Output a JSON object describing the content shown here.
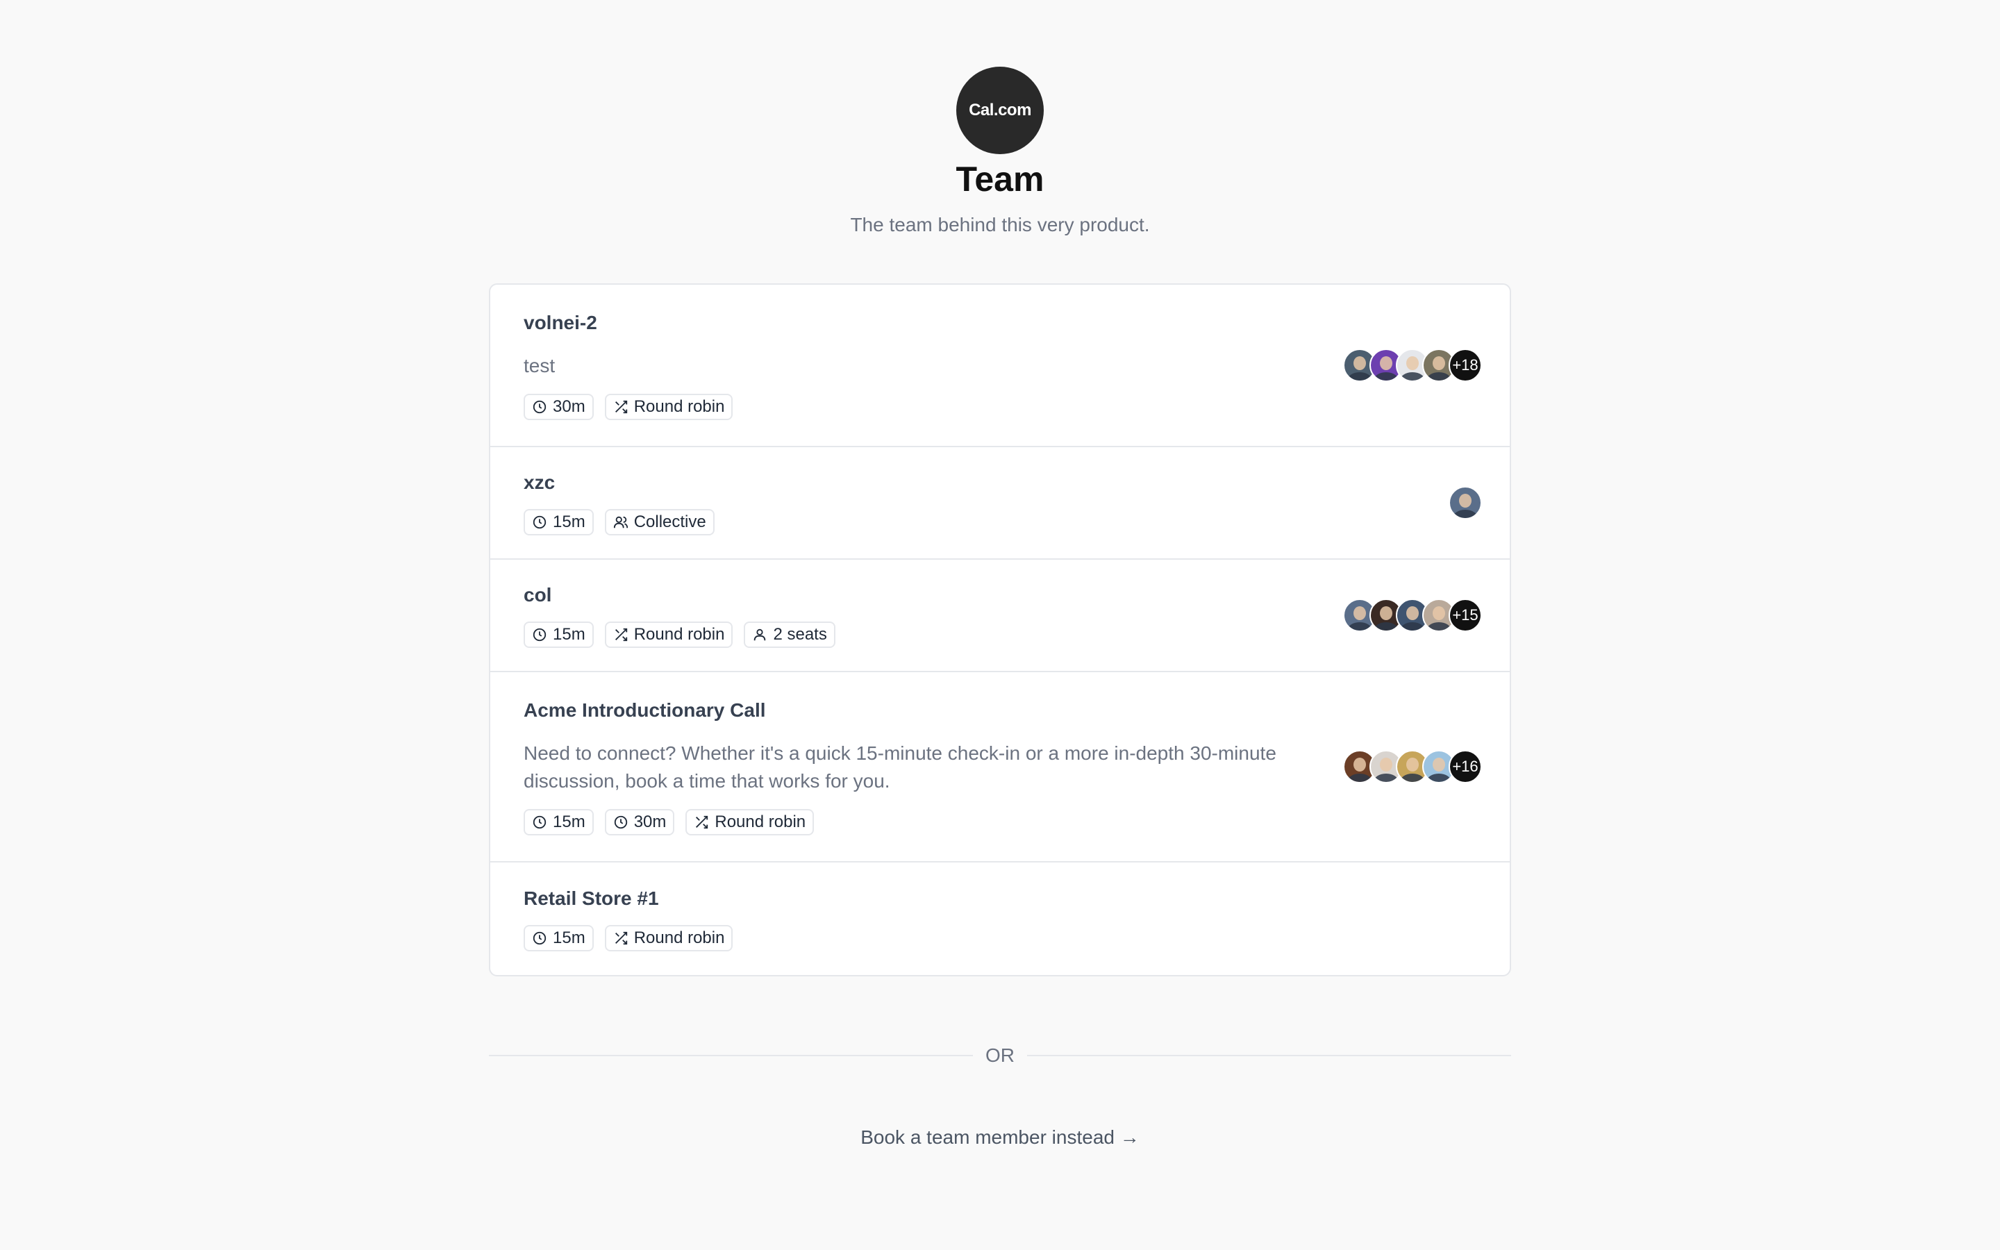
{
  "team": {
    "logo_text": "Cal.com",
    "name": "Team",
    "description": "The team behind this very product."
  },
  "events": [
    {
      "title": "volnei-2",
      "description": "test",
      "badges": [
        {
          "icon": "clock-icon",
          "label": "30m"
        },
        {
          "icon": "shuffle-icon",
          "label": "Round robin"
        }
      ],
      "avatars": [
        "#4b5e6f",
        "#6d3fb0",
        "#e5e7eb",
        "#7b7560"
      ],
      "more": "+18"
    },
    {
      "title": "xzc",
      "description": "",
      "badges": [
        {
          "icon": "clock-icon",
          "label": "15m"
        },
        {
          "icon": "users-icon",
          "label": "Collective"
        }
      ],
      "avatars": [
        "#5a6e8a"
      ],
      "more": ""
    },
    {
      "title": "col",
      "description": "",
      "badges": [
        {
          "icon": "clock-icon",
          "label": "15m"
        },
        {
          "icon": "shuffle-icon",
          "label": "Round robin"
        },
        {
          "icon": "user-icon",
          "label": "2 seats"
        }
      ],
      "avatars": [
        "#5a6e8a",
        "#3a2a24",
        "#3f5470",
        "#b9a99a"
      ],
      "more": "+15"
    },
    {
      "title": "Acme Introductionary Call",
      "description": "Need to connect? Whether it's a quick 15-minute check-in or a more in-depth 30-minute discussion, book a time that works for you.",
      "badges": [
        {
          "icon": "clock-icon",
          "label": "15m"
        },
        {
          "icon": "clock-icon",
          "label": "30m"
        },
        {
          "icon": "shuffle-icon",
          "label": "Round robin"
        }
      ],
      "avatars": [
        "#6b3e26",
        "#d9d4cf",
        "#c7a55a",
        "#9cc3e0"
      ],
      "more": "+16"
    },
    {
      "title": "Retail Store #1",
      "description": "",
      "badges": [
        {
          "icon": "clock-icon",
          "label": "15m"
        },
        {
          "icon": "shuffle-icon",
          "label": "Round robin"
        }
      ],
      "avatars": [],
      "more": ""
    }
  ],
  "divider_label": "OR",
  "book_member_link": "Book a team member instead →"
}
